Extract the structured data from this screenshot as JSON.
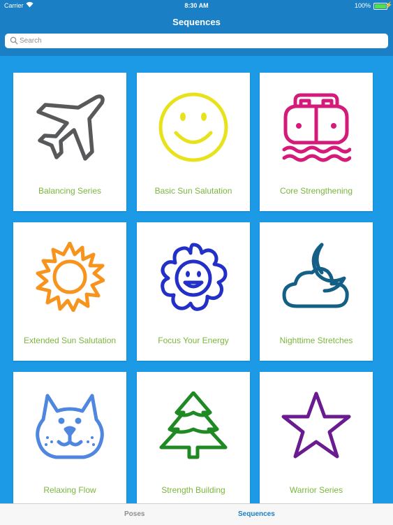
{
  "status_bar": {
    "carrier": "Carrier",
    "time": "8:30 AM",
    "battery": "100%"
  },
  "nav": {
    "title": "Sequences"
  },
  "search": {
    "placeholder": "Search",
    "value": ""
  },
  "sequences": [
    {
      "label": "Balancing Series",
      "icon": "airplane-icon",
      "color": "#58595b"
    },
    {
      "label": "Basic Sun Salutation",
      "icon": "smiley-face-icon",
      "color": "#e8e21b"
    },
    {
      "label": "Core Strengthening",
      "icon": "boat-icon",
      "color": "#d41b79"
    },
    {
      "label": "Extended Sun Salutation",
      "icon": "sun-icon",
      "color": "#f7941d"
    },
    {
      "label": "Focus Your Energy",
      "icon": "smiling-flower-icon",
      "color": "#2330c8"
    },
    {
      "label": "Nighttime Stretches",
      "icon": "moon-cloud-icon",
      "color": "#145f85"
    },
    {
      "label": "Relaxing Flow",
      "icon": "cat-face-icon",
      "color": "#4f86e0"
    },
    {
      "label": "Strength Building",
      "icon": "pine-tree-icon",
      "color": "#1f8a24"
    },
    {
      "label": "Warrior Series",
      "icon": "star-icon",
      "color": "#6a1b8f"
    }
  ],
  "label_color": "#7ab73c",
  "tabs": [
    {
      "label": "Poses",
      "selected": false
    },
    {
      "label": "Sequences",
      "selected": true
    }
  ],
  "accent_color": "#1a7fc4"
}
